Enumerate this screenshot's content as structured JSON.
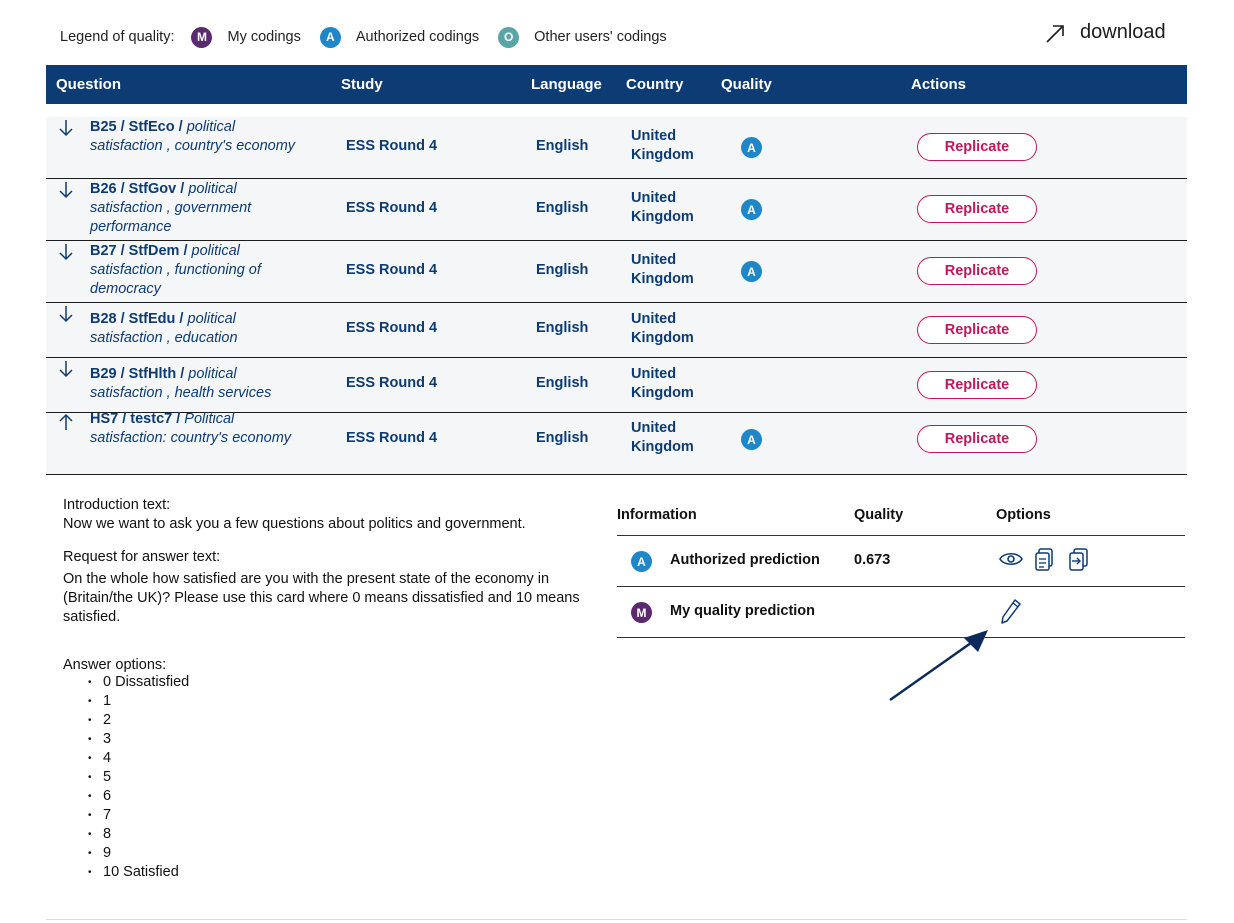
{
  "legend": {
    "label": "Legend of quality:",
    "items": [
      {
        "badge": "M",
        "label": "My codings"
      },
      {
        "badge": "A",
        "label": "Authorized codings"
      },
      {
        "badge": "O",
        "label": "Other users' codings"
      }
    ]
  },
  "download_label": "download",
  "table": {
    "headers": [
      "Question",
      "Study",
      "Language",
      "Country",
      "Quality",
      "Actions"
    ],
    "rows": [
      {
        "code": "B25 / StfEco / ",
        "desc": "political satisfaction , country's economy",
        "study": "ESS Round 4",
        "language": "English",
        "country": "United Kingdom",
        "quality": "A",
        "action": "Replicate"
      },
      {
        "code": "B26 / StfGov / ",
        "desc": "political satisfaction , government performance",
        "study": "ESS Round 4",
        "language": "English",
        "country": "United Kingdom",
        "quality": "A",
        "action": "Replicate"
      },
      {
        "code": "B27 / StfDem / ",
        "desc": "political satisfaction , functioning of democracy",
        "study": "ESS Round 4",
        "language": "English",
        "country": "United Kingdom",
        "quality": "A",
        "action": "Replicate"
      },
      {
        "code": "B28 / StfEdu / ",
        "desc": "political satisfaction , education",
        "study": "ESS Round 4",
        "language": "English",
        "country": "United Kingdom",
        "quality": "",
        "action": "Replicate"
      },
      {
        "code": "B29 / StfHlth / ",
        "desc": "political satisfaction , health services",
        "study": "ESS Round 4",
        "language": "English",
        "country": "United Kingdom",
        "quality": "",
        "action": "Replicate"
      },
      {
        "code": "HS7 / testc7 / ",
        "desc": "Political satisfaction: country's economy",
        "study": "ESS Round 4",
        "language": "English",
        "country": "United Kingdom",
        "quality": "A",
        "action": "Replicate"
      }
    ]
  },
  "detail": {
    "intro_label": "Introduction text:",
    "intro_text": "Now we want to ask you a few questions about politics and government.",
    "request_label": "Request for answer text:",
    "request_text": "On the whole how satisfied are you with the present state of the economy in (Britain/the UK)? Please use this card where 0 means dissatisfied and 10 means satisfied.",
    "answers_label": "Answer options:",
    "answers": [
      "0 Dissatisfied",
      "1",
      "2",
      "3",
      "4",
      "5",
      "6",
      "7",
      "8",
      "9",
      "10 Satisfied"
    ]
  },
  "info": {
    "headers": [
      "Information",
      "Quality",
      "Options"
    ],
    "rows": [
      {
        "badge": "A",
        "label": "Authorized prediction",
        "quality": "0.673"
      },
      {
        "badge": "M",
        "label": "My quality prediction",
        "quality": ""
      }
    ]
  },
  "colors": {
    "header_bg": "#0d3b73",
    "replicate": "#c2185b",
    "badge_m": "#5b2a6e",
    "badge_a": "#1f86c8",
    "badge_o": "#5aa5a8",
    "annotation_arrow": "#0d2a5c"
  }
}
